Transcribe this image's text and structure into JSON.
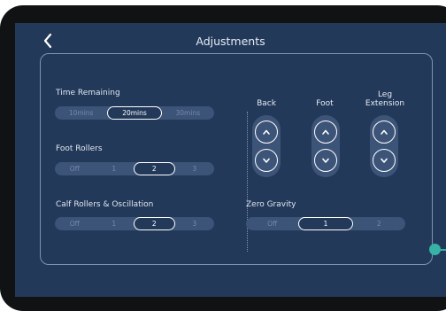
{
  "header": {
    "title": "Adjustments"
  },
  "time_remaining": {
    "label": "Time Remaining",
    "options": [
      "10mins",
      "20mins",
      "30mins"
    ],
    "selected": "20mins"
  },
  "foot_rollers": {
    "label": "Foot Rollers",
    "options": [
      "Off",
      "1",
      "2",
      "3"
    ],
    "selected": "2"
  },
  "calf_rollers": {
    "label": "Calf Rollers & Oscillation",
    "options": [
      "Off",
      "1",
      "2",
      "3"
    ],
    "selected": "2"
  },
  "position_controls": {
    "back": "Back",
    "foot": "Foot",
    "leg_extension_line1": "Leg",
    "leg_extension_line2": "Extension"
  },
  "zero_gravity": {
    "label": "Zero Gravity",
    "options": [
      "Off",
      "1",
      "2"
    ],
    "selected": "1"
  },
  "icons": {
    "back": "chevron-left-icon",
    "up": "chevron-up-icon",
    "down": "chevron-down-icon"
  },
  "colors": {
    "background": "#23395a",
    "track": "#3d5479",
    "accent": "#37b3a5",
    "frame": "#111214"
  }
}
